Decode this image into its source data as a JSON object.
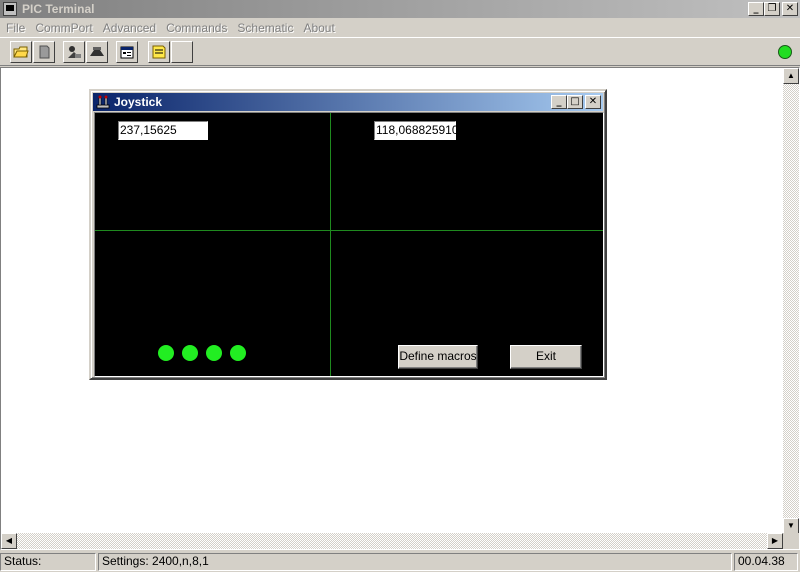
{
  "app": {
    "title": "PIC Terminal"
  },
  "menu": [
    {
      "label": "File"
    },
    {
      "label": "CommPort"
    },
    {
      "label": "Advanced"
    },
    {
      "label": "Commands"
    },
    {
      "label": "Schematic"
    },
    {
      "label": "About"
    }
  ],
  "toolbar": {
    "buttons": [
      "open-folder-icon",
      "document-icon",
      "connect-icon",
      "plug-icon",
      "properties-icon",
      "notes-icon",
      "blank-icon"
    ],
    "status_color": "#22dd22"
  },
  "joystick": {
    "title": "Joystick",
    "x_value": "237,15625",
    "y_value": "118,068825910",
    "grid_color": "#1f8a1f",
    "led_color": "#22ee22",
    "define_macros_label": "Define macros",
    "exit_label": "Exit"
  },
  "status": {
    "status_label": "Status:",
    "settings": "Settings: 2400,n,8,1",
    "time": "00.04.38"
  }
}
